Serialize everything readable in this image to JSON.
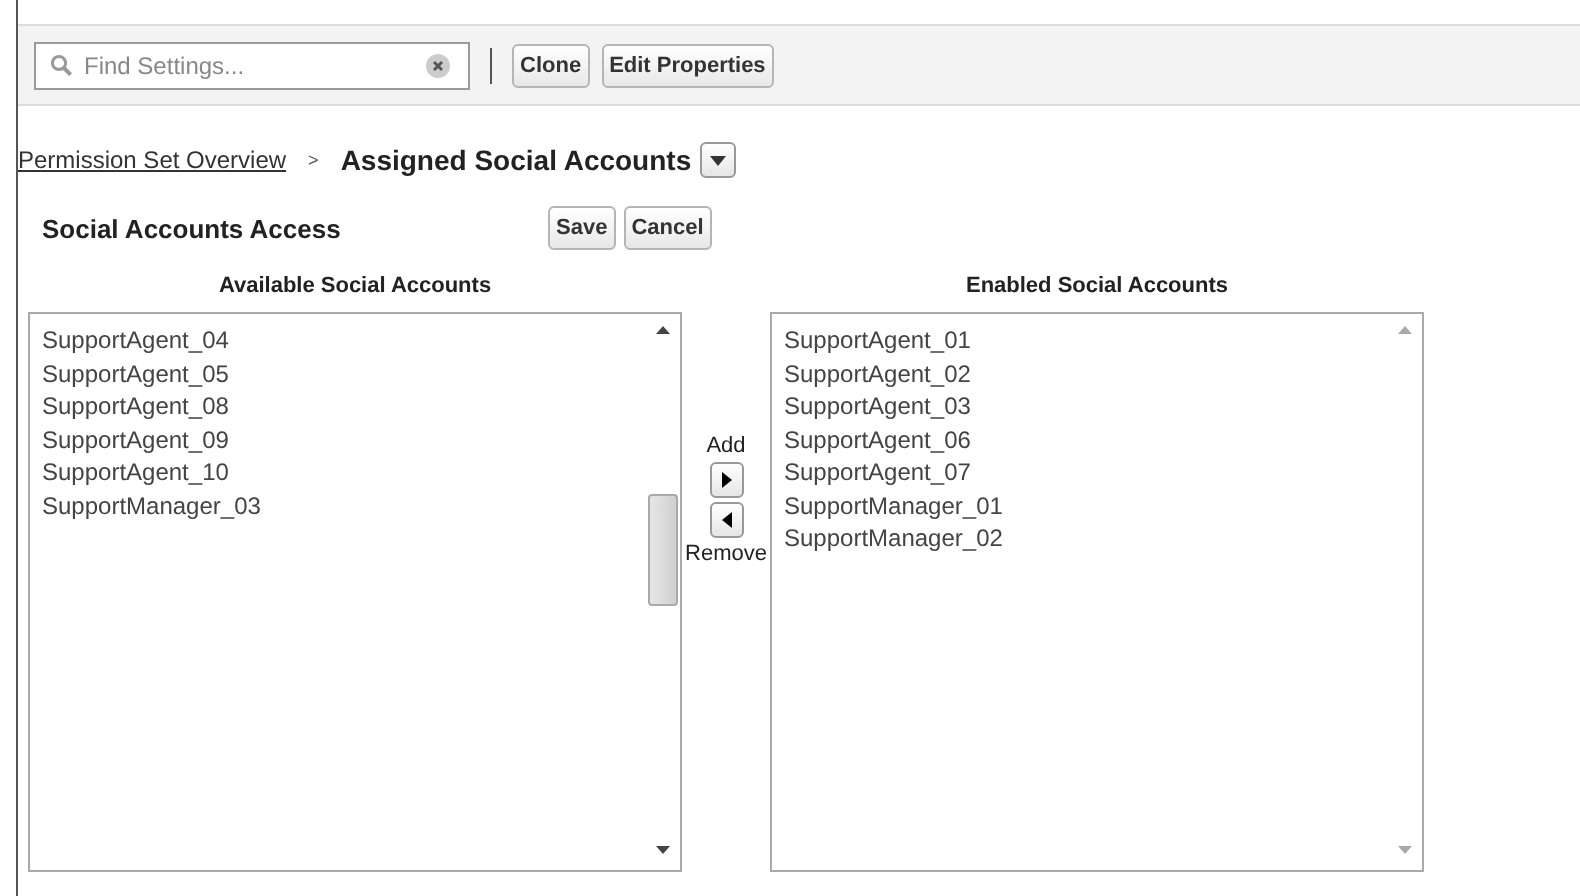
{
  "toolbar": {
    "search": {
      "placeholder": "Find Settings..."
    },
    "buttons": [
      "Clone",
      "Edit Properties"
    ]
  },
  "breadcrumb": {
    "link": "Permission Set Overview",
    "separator": ">",
    "current": "Assigned Social Accounts"
  },
  "section": {
    "title": "Social Accounts Access",
    "buttons": [
      "Save",
      "Cancel"
    ]
  },
  "available": {
    "heading": "Available Social Accounts",
    "items": [
      "SupportAgent_04",
      "SupportAgent_05",
      "SupportAgent_08",
      "SupportAgent_09",
      "SupportAgent_10",
      "SupportManager_03"
    ]
  },
  "mover": {
    "add_label": "Add",
    "remove_label": "Remove"
  },
  "enabled": {
    "heading": "Enabled Social Accounts",
    "items": [
      "SupportAgent_01",
      "SupportAgent_02",
      "SupportAgent_03",
      "SupportAgent_06",
      "SupportAgent_07",
      "SupportManager_01",
      "SupportManager_02"
    ]
  }
}
